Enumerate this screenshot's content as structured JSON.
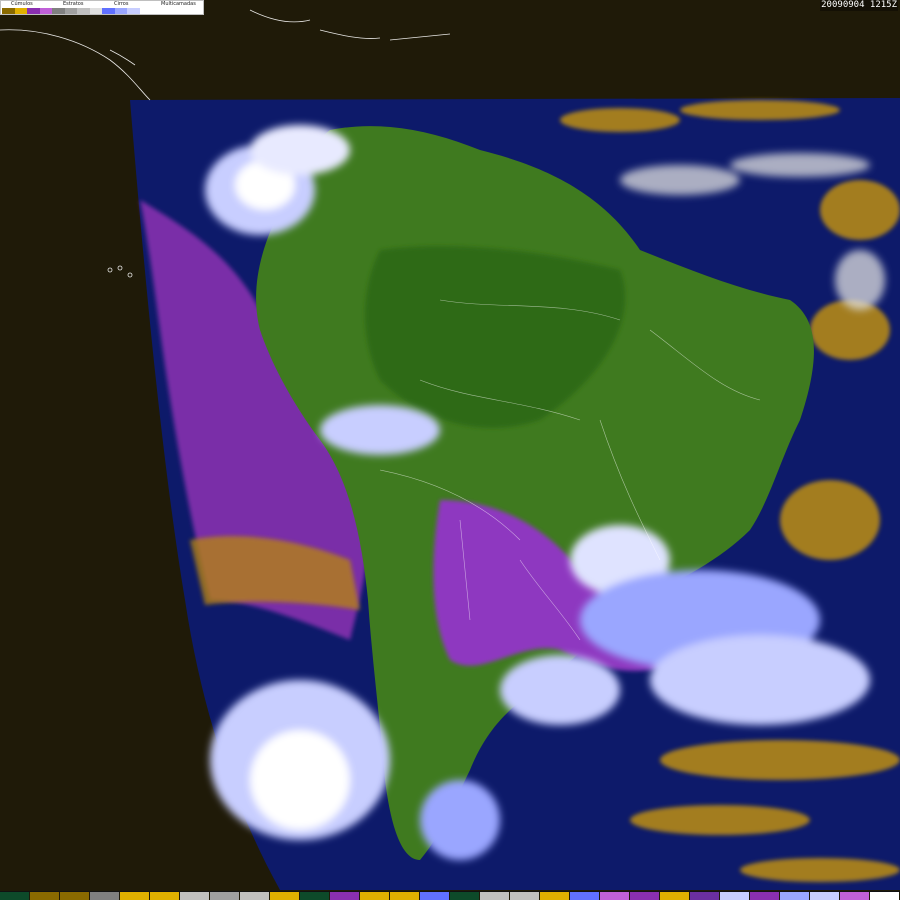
{
  "image": {
    "timestamp": "20090904 1215Z"
  },
  "legend": {
    "categories": [
      {
        "label": "Cúmulos",
        "colors": [
          "#8a6a00",
          "#e0b000"
        ]
      },
      {
        "label": "Estratos",
        "colors": [
          "#8a2fb0",
          "#c060d8"
        ]
      },
      {
        "label": "Cirros",
        "colors": [
          "#808080",
          "#a0a0a0",
          "#c0c0c0",
          "#e0e0e0"
        ]
      },
      {
        "label": "Multicamadas",
        "colors": [
          "#6070ff",
          "#9aa6ff",
          "#c8ceff",
          "#ffffff"
        ]
      }
    ]
  },
  "map": {
    "ocean_color": "#0d1a6a",
    "land_color": "#3f7a1f",
    "space_color": "#1f1a08",
    "coastline_color": "#ffffff"
  },
  "bottom_strip": {
    "colors": [
      "#0d4a2a",
      "#8a6a00",
      "#8a6a00",
      "#808080",
      "#e0b000",
      "#e0b000",
      "#c0c0c0",
      "#a0a0a0",
      "#c0c0c0",
      "#e0b000",
      "#0d4a2a",
      "#8a2fb0",
      "#e0b000",
      "#e0b000",
      "#6070ff",
      "#0d4a2a",
      "#c0c0c0",
      "#c0c0c0",
      "#e0b000",
      "#6070ff",
      "#c060d8",
      "#8a2fb0",
      "#e0b000",
      "#6b2fa0",
      "#c8ceff",
      "#8a2fb0",
      "#9aa6ff",
      "#c8ceff",
      "#c060d8",
      "#ffffff"
    ]
  }
}
